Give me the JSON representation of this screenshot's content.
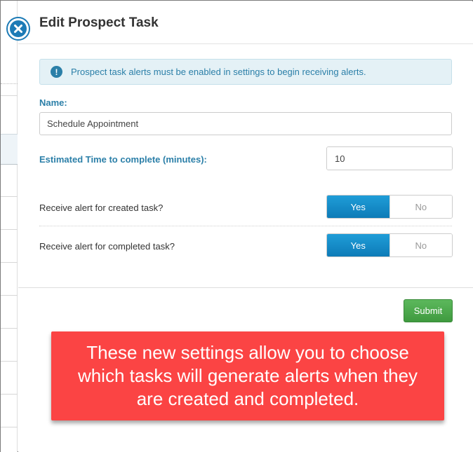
{
  "modal": {
    "title": "Edit Prospect Task",
    "alert_text": "Prospect task alerts must be enabled in settings to begin receiving alerts.",
    "alert_icon": "info-icon",
    "close_icon": "close-icon"
  },
  "form": {
    "name_label": "Name:",
    "name_value": "Schedule Appointment",
    "time_label": "Estimated Time to complete (minutes):",
    "time_value": "10",
    "time_unit": "min",
    "created_alert": {
      "label": "Receive alert for created task?",
      "yes": "Yes",
      "no": "No",
      "selected": "Yes"
    },
    "completed_alert": {
      "label": "Receive alert for completed task?",
      "yes": "Yes",
      "no": "No",
      "selected": "Yes"
    },
    "submit_label": "Submit"
  },
  "callout": {
    "text": "These new settings allow you to choose which tasks will generate alerts when they are created and completed."
  },
  "colors": {
    "accent_blue": "#2b7fa8",
    "toggle_active": "#1a8fcc",
    "submit_green": "#4cae4c",
    "callout_red": "#fb4444"
  }
}
